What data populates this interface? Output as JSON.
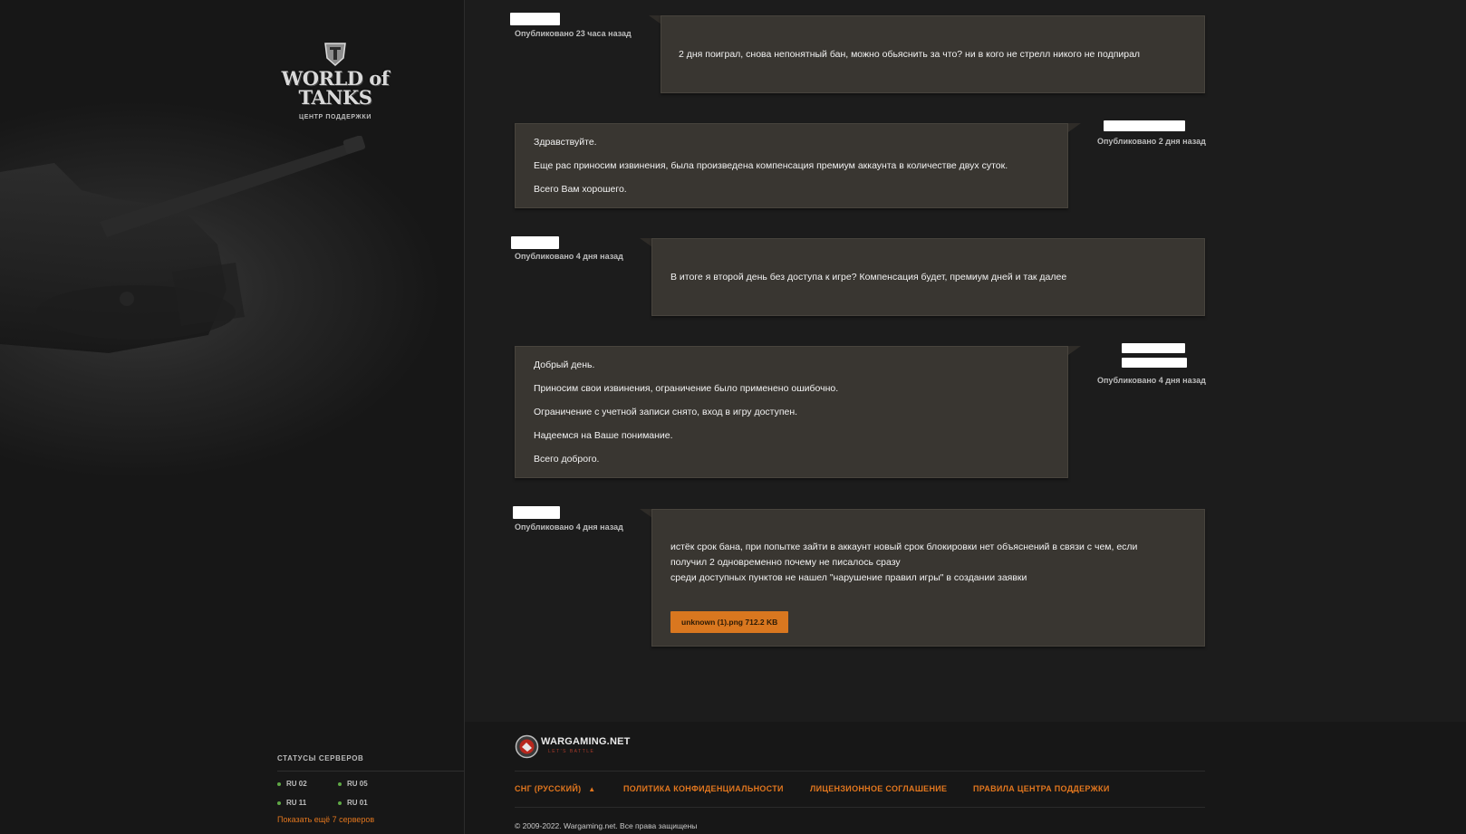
{
  "brand": {
    "logo_text": "WORLD of TANKS",
    "subtitle": "ЦЕНТР ПОДДЕРЖКИ"
  },
  "messages": [
    {
      "side": "user",
      "posted": "Опубликовано 23 часа назад",
      "lines": [
        "2 дня поиграл, снова непонятный бан, можно обьяснить за что? ни в кого не стрелл никого не подпирал"
      ]
    },
    {
      "side": "support",
      "posted": "Опубликовано 2 дня назад",
      "lines": [
        "Здравствуйте.",
        "Еще рас приносим извинения, была произведена компенсация премиум аккаунта в количестве двух суток.",
        "Всего Вам хорошего."
      ]
    },
    {
      "side": "user",
      "posted": "Опубликовано 4 дня назад",
      "lines": [
        "В итоге я второй день без доступа к игре? Компенсация будет, премиум дней и так далее"
      ]
    },
    {
      "side": "support",
      "posted": "Опубликовано 4 дня назад",
      "lines": [
        "Добрый день.",
        "Приносим свои извинения, ограничение было применено ошибочно.",
        "Ограничение с учетной записи снято, вход в игру доступен.",
        "Надеемся на Ваше понимание.",
        "Всего доброго."
      ]
    },
    {
      "side": "user",
      "posted": "Опубликовано 4 дня назад",
      "lines": [
        "истёк срок бана, при попытке зайти в аккаунт новый срок блокировки нет объяснений в связи с чем, если",
        "получил 2 одновременно почему не писалось сразу",
        "среди доступных пунктов не нашел \"нарушение правил игры\" в создании заявки"
      ],
      "attachment": {
        "name": "unknown (1).png",
        "size": "712.2 KB"
      }
    }
  ],
  "server_status": {
    "title": "СТАТУСЫ СЕРВЕРОВ",
    "servers": [
      "RU 02",
      "RU 05",
      "RU 11",
      "RU 01"
    ],
    "status_color": "#5fa846",
    "show_more": "Показать ещё 7 серверов"
  },
  "footer": {
    "brand": "WARGAMING.NET",
    "tagline": "LET'S BATTLE",
    "region": "СНГ (РУССКИЙ)",
    "links": [
      "ПОЛИТИКА КОНФИДЕНЦИАЛЬНОСТИ",
      "ЛИЦЕНЗИОННОЕ СОГЛАШЕНИЕ",
      "ПРАВИЛА ЦЕНТРА ПОДДЕРЖКИ"
    ],
    "copyright": "© 2009-2022. Wargaming.net. Все права защищены"
  },
  "colors": {
    "accent": "#e1761e",
    "bubble": "#393631",
    "page_bg": "#1c1c1c"
  }
}
